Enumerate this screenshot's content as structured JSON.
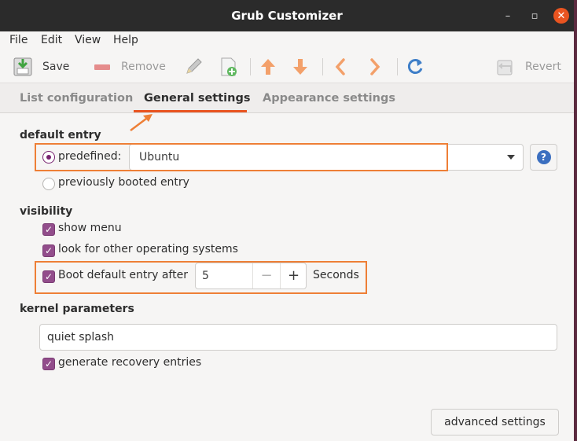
{
  "window": {
    "title": "Grub Customizer",
    "minimize_glyph": "–",
    "maximize_glyph": "▫",
    "close_glyph": "✕"
  },
  "menu": [
    "File",
    "Edit",
    "View",
    "Help"
  ],
  "toolbar": {
    "save_label": "Save",
    "remove_label": "Remove",
    "revert_label": "Revert"
  },
  "tabs": [
    {
      "label": "List configuration",
      "active": false
    },
    {
      "label": "General settings",
      "active": true
    },
    {
      "label": "Appearance settings",
      "active": false
    }
  ],
  "default_entry": {
    "heading": "default entry",
    "predefined_label": "predefined:",
    "predefined_selected": true,
    "predefined_value": "Ubuntu",
    "previously_booted_label": "previously booted entry",
    "help_glyph": "?"
  },
  "visibility": {
    "heading": "visibility",
    "show_menu_label": "show menu",
    "show_menu_checked": true,
    "look_for_os_label": "look for other operating systems",
    "look_for_os_checked": true,
    "boot_default_label": "Boot default entry after",
    "boot_default_checked": true,
    "timeout_value": "5",
    "minus_glyph": "−",
    "plus_glyph": "+",
    "seconds_label": "Seconds"
  },
  "kernel": {
    "heading": "kernel parameters",
    "value": "quiet splash",
    "recovery_label": "generate recovery entries",
    "recovery_checked": true
  },
  "advanced_button": "advanced settings",
  "colors": {
    "accent": "#e95420",
    "highlight": "#ee7f36",
    "check": "#924d8b",
    "radio": "#77216f",
    "titlebar": "#2b2b2b"
  }
}
